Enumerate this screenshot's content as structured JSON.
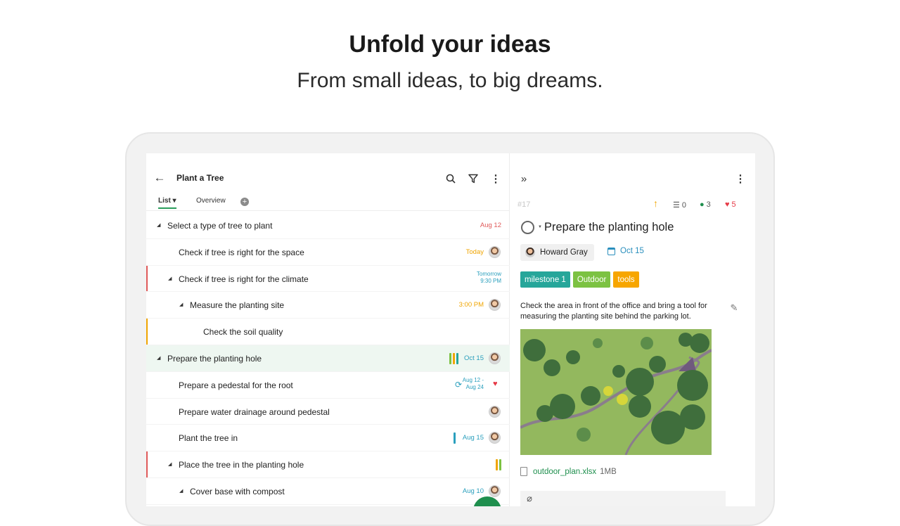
{
  "hero": {
    "title": "Unfold your ideas",
    "subtitle": "From small ideas, to big dreams."
  },
  "list_pane": {
    "project_title": "Plant a Tree",
    "tabs": [
      {
        "label": "List ▾"
      },
      {
        "label": "Overview"
      }
    ],
    "add_tab_label": "+",
    "rows": [
      {
        "title": "Select a type of tree to plant",
        "date": "Aug 12",
        "date_color": "#e05a5a"
      },
      {
        "title": "Check if tree is right for the space",
        "date": "Today",
        "date_color": "#f0a500"
      },
      {
        "title": "Check if tree is right for the climate",
        "date_line1": "Tomorrow",
        "date_line2": "9:30 PM",
        "date_color": "#2a9fbd",
        "bar_color": "#e05a5a"
      },
      {
        "title": "Measure the planting site",
        "date": "3:00 PM",
        "date_color": "#f0a500"
      },
      {
        "title": "Check the soil quality",
        "bar_color": "#f0a500"
      },
      {
        "title": "Prepare the planting hole",
        "date": "Oct 15",
        "date_color": "#2a9fbd",
        "stripe_colors": [
          "#7cc242",
          "#f0a500",
          "#26a69a"
        ]
      },
      {
        "title": "Prepare a pedestal for the root",
        "date_line1": "Aug 12 -",
        "date_line2": "Aug 24",
        "date_color": "#2a9fbd",
        "heart_color": "#e63946"
      },
      {
        "title": "Prepare water drainage around pedestal"
      },
      {
        "title": "Plant the tree in",
        "date": "Aug 15",
        "date_color": "#2a9fbd",
        "stripe_colors": [
          "#2a9fbd"
        ]
      },
      {
        "title": "Place the tree in the planting hole",
        "bar_color": "#e05a5a",
        "stripe_colors": [
          "#f0a500",
          "#7cc242"
        ]
      },
      {
        "title": "Cover base with compost",
        "date": "Aug 10",
        "date_color": "#2a9fbd"
      }
    ]
  },
  "detail_pane": {
    "task_id": "#17",
    "subtask_count": "0",
    "watcher_count": "3",
    "like_count": "5",
    "title": "Prepare the planting hole",
    "assignee": "Howard Gray",
    "due_date": "Oct 15",
    "tags": [
      {
        "label": "milestone 1",
        "color": "#26a69a"
      },
      {
        "label": "Outdoor",
        "color": "#7cc242"
      },
      {
        "label": "tools",
        "color": "#f7a600"
      }
    ],
    "description": "Check the area in front of the office and bring a tool for measuring the planting site behind the parking lot.",
    "attachment": {
      "name": "outdoor_plan.xlsx",
      "size": "1MB"
    }
  },
  "colors": {
    "accent": "#1f8f4e",
    "selected_row": "#eef7f1"
  },
  "icons": [
    "back-arrow-icon",
    "search-icon",
    "filter-icon",
    "more-icon",
    "collapse-icon",
    "priority-arrow-icon",
    "subtasks-icon",
    "eye-icon",
    "heart-icon",
    "calendar-icon",
    "pencil-icon",
    "file-icon",
    "paperclip-icon"
  ]
}
